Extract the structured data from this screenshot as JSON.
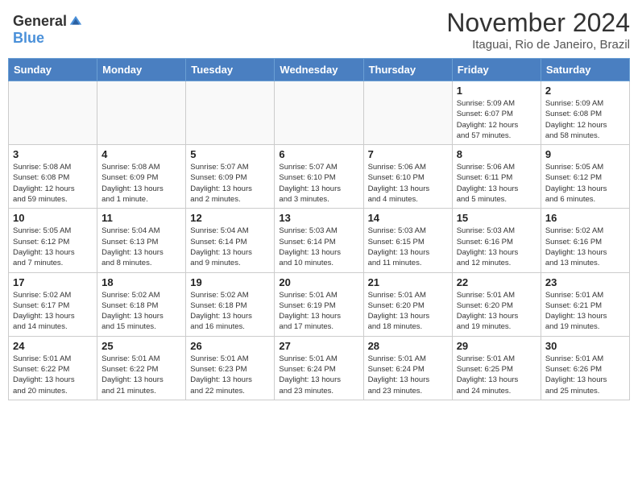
{
  "header": {
    "logo_general": "General",
    "logo_blue": "Blue",
    "title": "November 2024",
    "location": "Itaguai, Rio de Janeiro, Brazil"
  },
  "weekdays": [
    "Sunday",
    "Monday",
    "Tuesday",
    "Wednesday",
    "Thursday",
    "Friday",
    "Saturday"
  ],
  "weeks": [
    [
      {
        "day": "",
        "info": ""
      },
      {
        "day": "",
        "info": ""
      },
      {
        "day": "",
        "info": ""
      },
      {
        "day": "",
        "info": ""
      },
      {
        "day": "",
        "info": ""
      },
      {
        "day": "1",
        "info": "Sunrise: 5:09 AM\nSunset: 6:07 PM\nDaylight: 12 hours\nand 57 minutes."
      },
      {
        "day": "2",
        "info": "Sunrise: 5:09 AM\nSunset: 6:08 PM\nDaylight: 12 hours\nand 58 minutes."
      }
    ],
    [
      {
        "day": "3",
        "info": "Sunrise: 5:08 AM\nSunset: 6:08 PM\nDaylight: 12 hours\nand 59 minutes."
      },
      {
        "day": "4",
        "info": "Sunrise: 5:08 AM\nSunset: 6:09 PM\nDaylight: 13 hours\nand 1 minute."
      },
      {
        "day": "5",
        "info": "Sunrise: 5:07 AM\nSunset: 6:09 PM\nDaylight: 13 hours\nand 2 minutes."
      },
      {
        "day": "6",
        "info": "Sunrise: 5:07 AM\nSunset: 6:10 PM\nDaylight: 13 hours\nand 3 minutes."
      },
      {
        "day": "7",
        "info": "Sunrise: 5:06 AM\nSunset: 6:10 PM\nDaylight: 13 hours\nand 4 minutes."
      },
      {
        "day": "8",
        "info": "Sunrise: 5:06 AM\nSunset: 6:11 PM\nDaylight: 13 hours\nand 5 minutes."
      },
      {
        "day": "9",
        "info": "Sunrise: 5:05 AM\nSunset: 6:12 PM\nDaylight: 13 hours\nand 6 minutes."
      }
    ],
    [
      {
        "day": "10",
        "info": "Sunrise: 5:05 AM\nSunset: 6:12 PM\nDaylight: 13 hours\nand 7 minutes."
      },
      {
        "day": "11",
        "info": "Sunrise: 5:04 AM\nSunset: 6:13 PM\nDaylight: 13 hours\nand 8 minutes."
      },
      {
        "day": "12",
        "info": "Sunrise: 5:04 AM\nSunset: 6:14 PM\nDaylight: 13 hours\nand 9 minutes."
      },
      {
        "day": "13",
        "info": "Sunrise: 5:03 AM\nSunset: 6:14 PM\nDaylight: 13 hours\nand 10 minutes."
      },
      {
        "day": "14",
        "info": "Sunrise: 5:03 AM\nSunset: 6:15 PM\nDaylight: 13 hours\nand 11 minutes."
      },
      {
        "day": "15",
        "info": "Sunrise: 5:03 AM\nSunset: 6:16 PM\nDaylight: 13 hours\nand 12 minutes."
      },
      {
        "day": "16",
        "info": "Sunrise: 5:02 AM\nSunset: 6:16 PM\nDaylight: 13 hours\nand 13 minutes."
      }
    ],
    [
      {
        "day": "17",
        "info": "Sunrise: 5:02 AM\nSunset: 6:17 PM\nDaylight: 13 hours\nand 14 minutes."
      },
      {
        "day": "18",
        "info": "Sunrise: 5:02 AM\nSunset: 6:18 PM\nDaylight: 13 hours\nand 15 minutes."
      },
      {
        "day": "19",
        "info": "Sunrise: 5:02 AM\nSunset: 6:18 PM\nDaylight: 13 hours\nand 16 minutes."
      },
      {
        "day": "20",
        "info": "Sunrise: 5:01 AM\nSunset: 6:19 PM\nDaylight: 13 hours\nand 17 minutes."
      },
      {
        "day": "21",
        "info": "Sunrise: 5:01 AM\nSunset: 6:20 PM\nDaylight: 13 hours\nand 18 minutes."
      },
      {
        "day": "22",
        "info": "Sunrise: 5:01 AM\nSunset: 6:20 PM\nDaylight: 13 hours\nand 19 minutes."
      },
      {
        "day": "23",
        "info": "Sunrise: 5:01 AM\nSunset: 6:21 PM\nDaylight: 13 hours\nand 19 minutes."
      }
    ],
    [
      {
        "day": "24",
        "info": "Sunrise: 5:01 AM\nSunset: 6:22 PM\nDaylight: 13 hours\nand 20 minutes."
      },
      {
        "day": "25",
        "info": "Sunrise: 5:01 AM\nSunset: 6:22 PM\nDaylight: 13 hours\nand 21 minutes."
      },
      {
        "day": "26",
        "info": "Sunrise: 5:01 AM\nSunset: 6:23 PM\nDaylight: 13 hours\nand 22 minutes."
      },
      {
        "day": "27",
        "info": "Sunrise: 5:01 AM\nSunset: 6:24 PM\nDaylight: 13 hours\nand 23 minutes."
      },
      {
        "day": "28",
        "info": "Sunrise: 5:01 AM\nSunset: 6:24 PM\nDaylight: 13 hours\nand 23 minutes."
      },
      {
        "day": "29",
        "info": "Sunrise: 5:01 AM\nSunset: 6:25 PM\nDaylight: 13 hours\nand 24 minutes."
      },
      {
        "day": "30",
        "info": "Sunrise: 5:01 AM\nSunset: 6:26 PM\nDaylight: 13 hours\nand 25 minutes."
      }
    ]
  ]
}
